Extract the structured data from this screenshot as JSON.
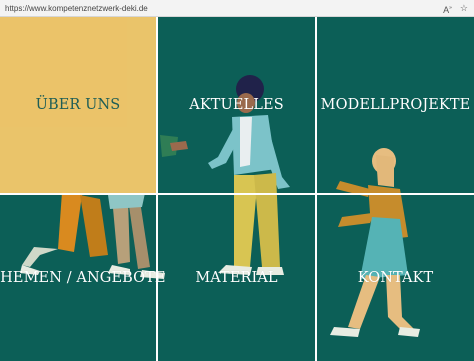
{
  "browser": {
    "url": "https://www.kompetenznetzwerk-deki.de",
    "icons": [
      "read-aloud-icon",
      "favorite-star-icon"
    ]
  },
  "colors": {
    "background": "#0c5f57",
    "active_tile": "#f7c96b",
    "grid_lines": "#ffffff"
  },
  "tiles": [
    {
      "label": "ÜBER UNS",
      "active": true
    },
    {
      "label": "AKTUELLES",
      "active": false
    },
    {
      "label": "MODELLPROJEKTE",
      "active": false
    },
    {
      "label": "THEMEN / ANGEBOTE",
      "active": false
    },
    {
      "label": "MATERIAL",
      "active": false
    },
    {
      "label": "KONTAKT",
      "active": false
    }
  ]
}
